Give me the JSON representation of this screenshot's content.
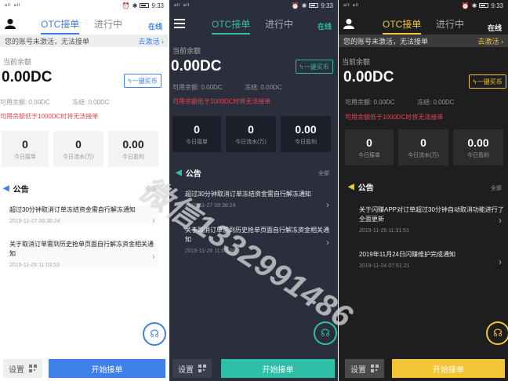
{
  "status": {
    "signal": "ᵃˡˡ ᵃˡˡ",
    "time": "9:33"
  },
  "header": {
    "tab_active": "OTC接单",
    "tab_other": "进行中",
    "online": "在线"
  },
  "notice": {
    "text": "您的账号未激活，无法接单",
    "action": "去激活 ›"
  },
  "balance": {
    "title": "当前余额",
    "amount": "0.00DC",
    "buy_label": "一键买币",
    "available": "可用余额: 0.00DC",
    "frozen": "冻结: 0.00DC",
    "warning": "可用余额低于1000DC时将无法接单"
  },
  "stats": [
    {
      "value": "0",
      "label": "今日接单"
    },
    {
      "value": "0",
      "label": "今日流水(万)"
    },
    {
      "value": "0.00",
      "label": "今日盈利"
    }
  ],
  "announcements": {
    "title": "公告",
    "all": "全部",
    "screen1": [
      {
        "title": "超过30分钟取消订单冻结资金需自行解冻通知",
        "date": "2019-11-27 09:38:24"
      },
      {
        "title": "关于取消订单需到历史抢单页面自行解冻资金相关通知",
        "date": "2019-11-26 11:03:53"
      }
    ],
    "screen2": [
      {
        "title": "超过30分钟取消订单冻结资金需自行解冻通知",
        "date": "2019-11-27 09:38:24"
      },
      {
        "title": "关于取消订单需到历史抢单页面自行解冻资金相关通知",
        "date": "2019-11-26 11:03:36"
      }
    ],
    "screen3": [
      {
        "title": "关于闪赚APP对订单超过30分钟自动取消功能进行了全面更新",
        "date": "2019-11-26 11:31:51"
      },
      {
        "title": "2019年11月24日闪赚维护完成通知",
        "date": "2019-11-24 07:51:21"
      }
    ]
  },
  "bottom": {
    "settings": "设置",
    "start": "开始接单"
  },
  "watermark": "微信1332991486",
  "colors": {
    "blue": "#3f7fe9",
    "teal": "#2fbfa6",
    "yellow": "#f2c535",
    "red": "#e8464e",
    "dark2": "#2a2e3d",
    "dark3": "#1e1e20"
  }
}
